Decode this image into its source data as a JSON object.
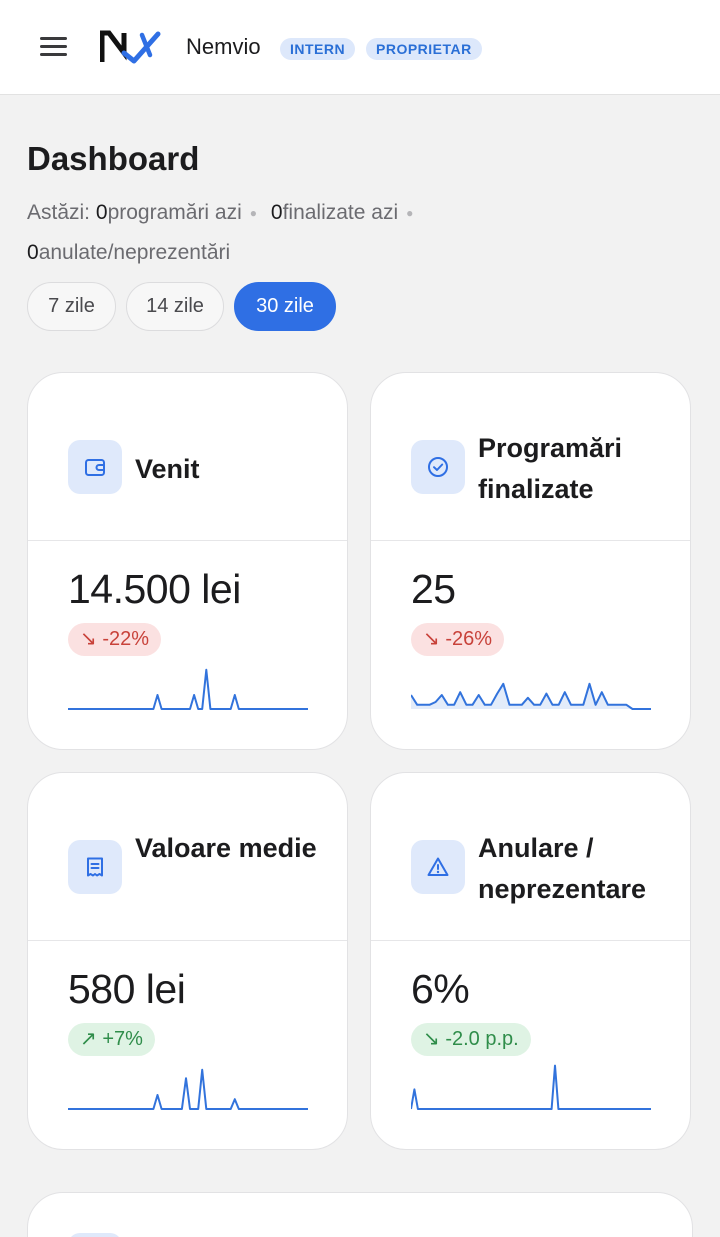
{
  "header": {
    "brand": "Nemvio",
    "badges": [
      "INTERN",
      "PROPRIETAR"
    ]
  },
  "page": {
    "title": "Dashboard",
    "today_label": "Astăzi:",
    "today_stats": [
      {
        "value": "0",
        "label": "programări azi"
      },
      {
        "value": "0",
        "label": "finalizate azi"
      },
      {
        "value": "0",
        "label": "anulate/neprezentări"
      }
    ]
  },
  "ranges": [
    {
      "label": "7 zile",
      "active": false
    },
    {
      "label": "14 zile",
      "active": false
    },
    {
      "label": "30 zile",
      "active": true
    }
  ],
  "cards": [
    {
      "title": "Venit",
      "icon": "wallet-icon",
      "value": "14.500 lei",
      "delta": "↘ -22%",
      "tone": "down",
      "sparkline": [
        0,
        0,
        0,
        0,
        0,
        0,
        0,
        0,
        0,
        0,
        0,
        0,
        0,
        0,
        0,
        0,
        0,
        0,
        0,
        0,
        0,
        0,
        1,
        0,
        0,
        0,
        0,
        0,
        0,
        0,
        0,
        1,
        0,
        0,
        2.8,
        0,
        0,
        0,
        0,
        0,
        0,
        1,
        0,
        0,
        0,
        0,
        0,
        0,
        0,
        0,
        0,
        0,
        0,
        0,
        0,
        0,
        0,
        0,
        0,
        0
      ],
      "fill": false
    },
    {
      "title": "Programări finalizate",
      "icon": "check-circle-icon",
      "value": "25",
      "delta": "↘ -26%",
      "tone": "down",
      "sparkline": [
        1,
        0.3,
        0.3,
        0.3,
        0.5,
        1,
        0.3,
        0.3,
        1.2,
        0.3,
        0.3,
        1,
        0.3,
        0.3,
        1.1,
        1.8,
        0.3,
        0.3,
        0.3,
        0.8,
        0.3,
        0.3,
        1.1,
        0.3,
        0.3,
        1.2,
        0.3,
        0.3,
        0.3,
        1.8,
        0.3,
        1.2,
        0.3,
        0.3,
        0.3,
        0.3,
        0,
        0,
        0,
        0
      ],
      "fill": true
    },
    {
      "title": "Valoare medie",
      "icon": "receipt-icon",
      "value": "580 lei",
      "delta": "↗ +7%",
      "tone": "good",
      "sparkline": [
        0,
        0,
        0,
        0,
        0,
        0,
        0,
        0,
        0,
        0,
        0,
        0,
        0,
        0,
        0,
        0,
        0,
        0,
        0,
        0,
        0,
        0,
        1,
        0,
        0,
        0,
        0,
        0,
        0,
        2.2,
        0,
        0,
        0,
        2.8,
        0,
        0,
        0,
        0,
        0,
        0,
        0,
        0.7,
        0,
        0,
        0,
        0,
        0,
        0,
        0,
        0,
        0,
        0,
        0,
        0,
        0,
        0,
        0,
        0,
        0,
        0
      ],
      "fill": false
    },
    {
      "title": "Anulare / neprezentare",
      "icon": "warning-icon",
      "value": "6%",
      "delta": "↘ -2.0 p.p.",
      "tone": "good",
      "sparkline": [
        0,
        1.4,
        0,
        0,
        0,
        0,
        0,
        0,
        0,
        0,
        0,
        0,
        0,
        0,
        0,
        0,
        0,
        0,
        0,
        0,
        0,
        0,
        0,
        0,
        0,
        0,
        0,
        0,
        0,
        0,
        0,
        0,
        0,
        0,
        0,
        0,
        0,
        0,
        0,
        0,
        0,
        0,
        3.1,
        0,
        0,
        0,
        0,
        0,
        0,
        0,
        0,
        0,
        0,
        0,
        0,
        0,
        0,
        0,
        0,
        0,
        0,
        0,
        0,
        0,
        0,
        0,
        0,
        0,
        0,
        0,
        0
      ],
      "fill": false
    }
  ],
  "colors": {
    "accent": "#2f6fe4",
    "badge_bg": "#dde8fb",
    "down_bg": "#fbe1e1",
    "down_fg": "#c8423a",
    "good_bg": "#dff3e4",
    "good_fg": "#2f8d4a",
    "spark": "#3273dc"
  }
}
